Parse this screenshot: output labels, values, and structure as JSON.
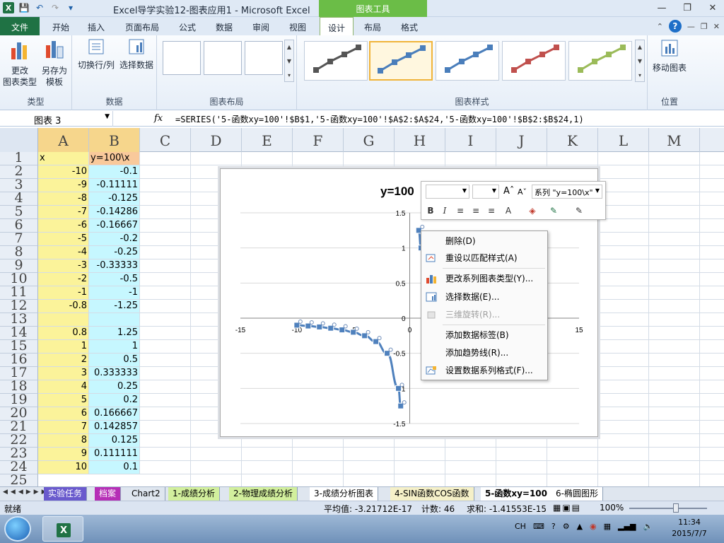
{
  "titlebar": {
    "title": "Excel导学实验12-图表应用1 - Microsoft Excel",
    "context_tab": "图表工具"
  },
  "ribbon_tabs": {
    "file": "文件",
    "items": [
      "开始",
      "插入",
      "页面布局",
      "公式",
      "数据",
      "审阅",
      "视图",
      "设计",
      "布局",
      "格式"
    ],
    "active": "设计"
  },
  "ribbon": {
    "type_group": {
      "label": "类型",
      "change_type": "更改\n图表类型",
      "change_type_l1": "更改",
      "change_type_l2": "图表类型",
      "save_template_l1": "另存为",
      "save_template_l2": "模板"
    },
    "data_group": {
      "label": "数据",
      "switch_row_col": "切换行/列",
      "select_data": "选择数据"
    },
    "layout_group": {
      "label": "图表布局"
    },
    "style_group": {
      "label": "图表样式"
    },
    "location_group": {
      "label": "位置",
      "move_chart": "移动图表"
    }
  },
  "formula_bar": {
    "name_box": "图表 3",
    "fx": "fx",
    "formula": "=SERIES('5-函数xy=100'!$B$1,'5-函数xy=100'!$A$2:$A$24,'5-函数xy=100'!$B$2:$B$24,1)"
  },
  "columns": [
    "A",
    "B",
    "C",
    "D",
    "E",
    "F",
    "G",
    "H",
    "I",
    "J",
    "K",
    "L",
    "M"
  ],
  "rows": [
    "1",
    "2",
    "3",
    "4",
    "5",
    "6",
    "7",
    "8",
    "9",
    "10",
    "11",
    "12",
    "13",
    "14",
    "15",
    "16",
    "17",
    "18",
    "19",
    "20",
    "21",
    "22",
    "23",
    "24",
    "25"
  ],
  "table": {
    "header_a": "x",
    "header_b": "y=100\\x",
    "a": [
      "-10",
      "-9",
      "-8",
      "-7",
      "-6",
      "-5",
      "-4",
      "-3",
      "-2",
      "-1",
      "-0.8",
      "",
      "0.8",
      "1",
      "2",
      "3",
      "4",
      "5",
      "6",
      "7",
      "8",
      "9",
      "10"
    ],
    "b": [
      "-0.1",
      "-0.11111",
      "-0.125",
      "-0.14286",
      "-0.16667",
      "-0.2",
      "-0.25",
      "-0.33333",
      "-0.5",
      "-1",
      "-1.25",
      "",
      "1.25",
      "1",
      "0.5",
      "0.333333",
      "0.25",
      "0.2",
      "0.166667",
      "0.142857",
      "0.125",
      "0.111111",
      "0.1"
    ]
  },
  "chart_data": {
    "type": "scatter",
    "title": "y=100",
    "x_ticks": [
      "-15",
      "-10",
      "-5",
      "0",
      "5",
      "10",
      "15"
    ],
    "y_ticks": [
      "1.5",
      "1",
      "0.5",
      "0",
      "-0.5",
      "-1",
      "-1.5"
    ],
    "xlim": [
      -15,
      15
    ],
    "ylim": [
      -1.5,
      1.5
    ],
    "series_color": "#4f81bd",
    "series": [
      {
        "name": "y=100\\x",
        "x": [
          -10,
          -9,
          -8,
          -7,
          -6,
          -5,
          -4,
          -3,
          -2,
          -1,
          -0.8,
          0.8,
          1,
          2,
          3,
          4,
          5,
          6,
          7,
          8,
          9,
          10
        ],
        "y": [
          -0.1,
          -0.11111,
          -0.125,
          -0.14286,
          -0.16667,
          -0.2,
          -0.25,
          -0.33333,
          -0.5,
          -1,
          -1.25,
          1.25,
          1,
          0.5,
          0.333333,
          0.25,
          0.2,
          0.166667,
          0.142857,
          0.125,
          0.111111,
          0.1
        ]
      }
    ]
  },
  "mini_toolbar": {
    "series_select": "系列 \"y=100\\x\"",
    "bold": "B",
    "italic": "I",
    "font_color": "A"
  },
  "context_menu": {
    "items": [
      {
        "label": "删除(D)",
        "disabled": false,
        "icon": "none"
      },
      {
        "label": "重设以匹配样式(A)",
        "disabled": false,
        "icon": "reset-style-icon"
      },
      {
        "label": "更改系列图表类型(Y)...",
        "disabled": false,
        "icon": "chart-type-icon"
      },
      {
        "label": "选择数据(E)...",
        "disabled": false,
        "icon": "select-data-icon"
      },
      {
        "label": "三维旋转(R)...",
        "disabled": true,
        "icon": "3d-rotate-icon"
      },
      {
        "label": "添加数据标签(B)",
        "disabled": false,
        "icon": "none"
      },
      {
        "label": "添加趋势线(R)...",
        "disabled": false,
        "icon": "none"
      },
      {
        "label": "设置数据系列格式(F)...",
        "disabled": false,
        "icon": "format-series-icon"
      }
    ]
  },
  "sheet_tabs": {
    "items": [
      "实验任务",
      "档案",
      "Chart2",
      "1-成绩分析",
      "2-物理成绩分析",
      "3-成绩分析图表",
      "4-SIN函数COS函数",
      "5-函数xy=100",
      "6-椭圆图形"
    ],
    "active": "5-函数xy=100"
  },
  "status": {
    "ready": "就绪",
    "average": "平均值: -3.21712E-17",
    "count": "计数: 46",
    "sum": "求和: -1.41553E-15",
    "zoom": "100%"
  },
  "taskbar": {
    "lang": "CH",
    "time": "11:34",
    "date": "2015/7/7"
  }
}
